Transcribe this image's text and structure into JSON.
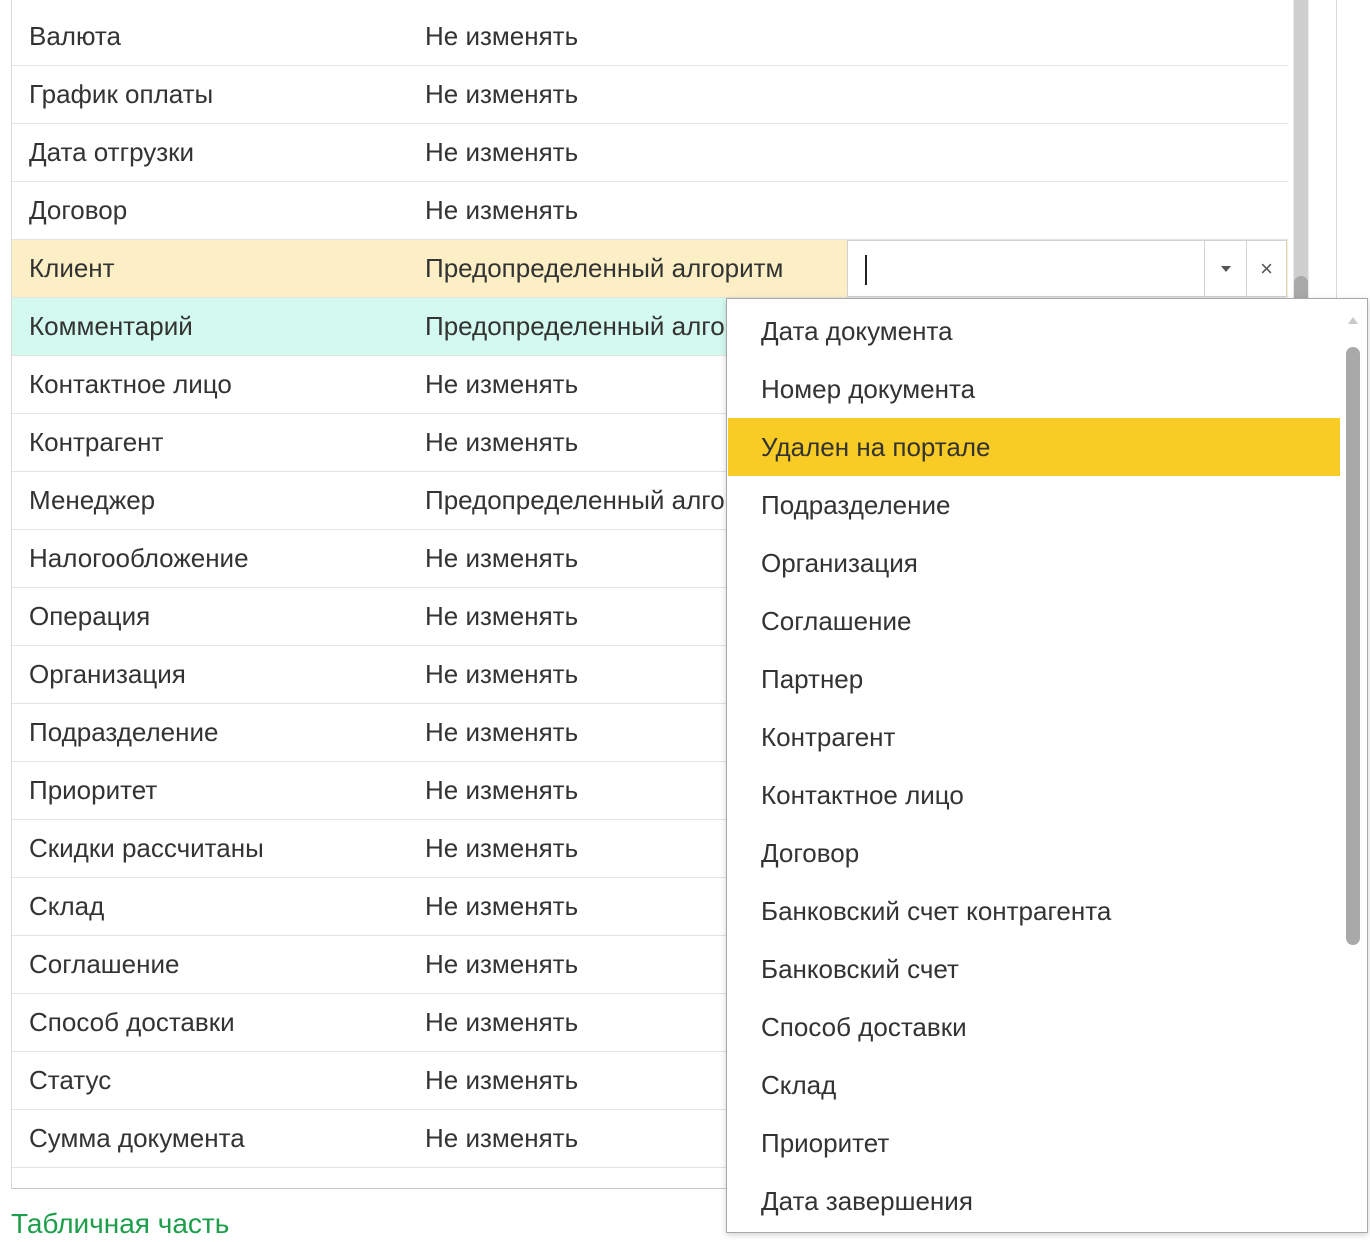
{
  "table": {
    "rows": [
      {
        "name": "Валюта",
        "value": "Не изменять"
      },
      {
        "name": "График оплаты",
        "value": "Не изменять"
      },
      {
        "name": "Дата отгрузки",
        "value": "Не изменять"
      },
      {
        "name": "Договор",
        "value": "Не изменять"
      },
      {
        "name": "Клиент",
        "value": "Предопределенный алгоритм",
        "state": "selected"
      },
      {
        "name": "Комментарий",
        "value": "Предопределенный алгоритм",
        "state": "current"
      },
      {
        "name": "Контактное лицо",
        "value": "Не изменять"
      },
      {
        "name": "Контрагент",
        "value": "Не изменять"
      },
      {
        "name": "Менеджер",
        "value": "Предопределенный алгоритм"
      },
      {
        "name": "Налогообложение",
        "value": "Не изменять"
      },
      {
        "name": "Операция",
        "value": "Не изменять"
      },
      {
        "name": "Организация",
        "value": "Не изменять"
      },
      {
        "name": "Подразделение",
        "value": "Не изменять"
      },
      {
        "name": "Приоритет",
        "value": "Не изменять"
      },
      {
        "name": "Скидки рассчитаны",
        "value": "Не изменять"
      },
      {
        "name": "Склад",
        "value": "Не изменять"
      },
      {
        "name": "Соглашение",
        "value": "Не изменять"
      },
      {
        "name": "Способ доставки",
        "value": "Не изменять"
      },
      {
        "name": "Статус",
        "value": "Не изменять"
      },
      {
        "name": "Сумма документа",
        "value": "Не изменять"
      },
      {
        "name": "",
        "value": ""
      }
    ]
  },
  "editor": {
    "value": "",
    "dropdown_icon": "triangle-down-icon",
    "clear_icon": "close-icon",
    "clear_glyph": "×"
  },
  "dropdown": {
    "items": [
      "Дата документа",
      "Номер документа",
      "Удален на портале",
      "Подразделение",
      "Организация",
      "Соглашение",
      "Партнер",
      "Контрагент",
      "Контактное лицо",
      "Договор",
      "Банковский счет контрагента",
      "Банковский счет",
      "Способ доставки",
      "Склад",
      "Приоритет",
      "Дата завершения"
    ],
    "highlighted_index": 2,
    "highlight_color": "#f8cc24"
  },
  "footer": {
    "section_title": "Табличная часть"
  },
  "colors": {
    "selected_row": "#fcefc5",
    "current_row": "#d4faf0",
    "section_title": "#1c9e4a"
  }
}
